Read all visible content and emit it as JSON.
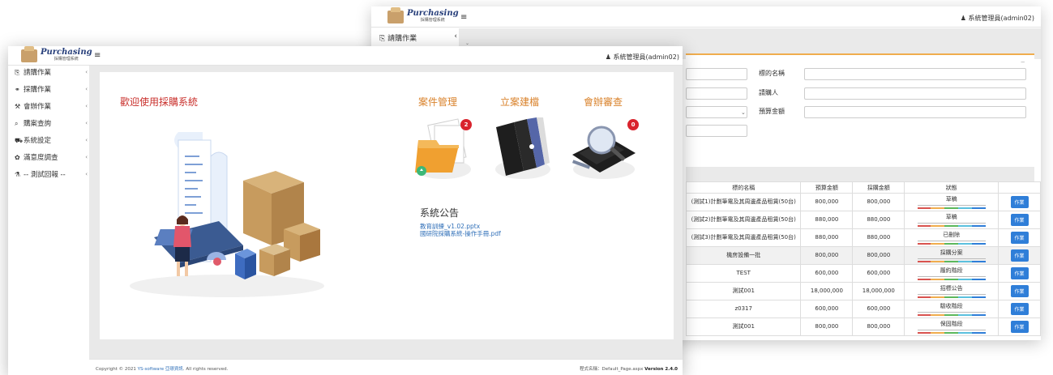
{
  "brand": {
    "name": "Purchasing",
    "subtitle": "採購管理系統"
  },
  "header": {
    "menu_icon": "≡",
    "user": "系統管理員(admin02)",
    "user_icon": "user-icon"
  },
  "sidebar": {
    "items": [
      {
        "label": "請購作業",
        "icon": "clipboard-icon",
        "glyph": "⎘"
      },
      {
        "label": "採購作業",
        "icon": "handshake-icon",
        "glyph": "⚭"
      },
      {
        "label": "會辦作業",
        "icon": "gavel-icon",
        "glyph": "⚒"
      },
      {
        "label": "購案查詢",
        "icon": "search-icon",
        "glyph": "⌕"
      },
      {
        "label": "系統設定",
        "icon": "cart-icon",
        "glyph": "⛟"
      },
      {
        "label": "滿意度調查",
        "icon": "gear-icon",
        "glyph": "✿"
      },
      {
        "label": "-- 測試回報 --",
        "icon": "flask-icon",
        "glyph": "⚗"
      }
    ]
  },
  "main": {
    "welcome": "歡迎使用採購系統",
    "modules": [
      {
        "title": "案件管理",
        "icon": "folder-icon",
        "badge": "2"
      },
      {
        "title": "立案建檔",
        "icon": "binders-icon",
        "badge": ""
      },
      {
        "title": "會辦審查",
        "icon": "calculator-icon",
        "badge": "0"
      }
    ],
    "notice": {
      "title": "系統公告",
      "links": [
        "教育訓練_v1.02.pptx",
        "國研院採購系統-操作手冊.pdf"
      ]
    }
  },
  "footer": {
    "copyright_prefix": "Copyright © 2021 ",
    "company": "YS-software 亞璟資訊",
    "copyright_suffix": ". All rights reserved.",
    "page_label": "程式名稱：Default_Page.aspx",
    "version": "Version 2.4.0"
  },
  "back_window": {
    "sidebar_item": "請購作業",
    "form": {
      "labels": [
        "標的名稱",
        "請購人",
        "預算金額"
      ]
    },
    "table": {
      "headers": [
        "標的名稱",
        "預算金額",
        "採購金額",
        "狀態",
        ""
      ],
      "rows": [
        {
          "name": "(測試1)計劃筆電及其周邊產品租賃(50台)",
          "budget": "800,000",
          "purchase": "800,000",
          "status": "草稿",
          "action": "作業"
        },
        {
          "name": "(測試2)計劃筆電及其周邊產品租賃(50台)",
          "budget": "880,000",
          "purchase": "880,000",
          "status": "草稿",
          "action": "作業"
        },
        {
          "name": "(測試3)計劃筆電及其周邊產品租賃(50台)",
          "budget": "880,000",
          "purchase": "880,000",
          "status": "已刪除",
          "action": "作業"
        },
        {
          "name": "機房設備一批",
          "budget": "800,000",
          "purchase": "800,000",
          "status": "採購分案",
          "action": "作業"
        },
        {
          "name": "TEST",
          "budget": "600,000",
          "purchase": "600,000",
          "status": "履約階段",
          "action": "作業"
        },
        {
          "name": "測試001",
          "budget": "18,000,000",
          "purchase": "18,000,000",
          "status": "招標公告",
          "action": "作業"
        },
        {
          "name": "z0317",
          "budget": "600,000",
          "purchase": "600,000",
          "status": "驗收階段",
          "action": "作業"
        },
        {
          "name": "測試001",
          "budget": "800,000",
          "purchase": "800,000",
          "status": "保固階段",
          "action": "作業"
        }
      ]
    }
  },
  "colors": {
    "accent_red": "#c9302c",
    "module_orange": "#d9822b",
    "link_blue": "#2f6fb8",
    "button_blue": "#2f7ed8",
    "badge_red": "#d9232d",
    "form_top_border": "#f0ad4e"
  }
}
